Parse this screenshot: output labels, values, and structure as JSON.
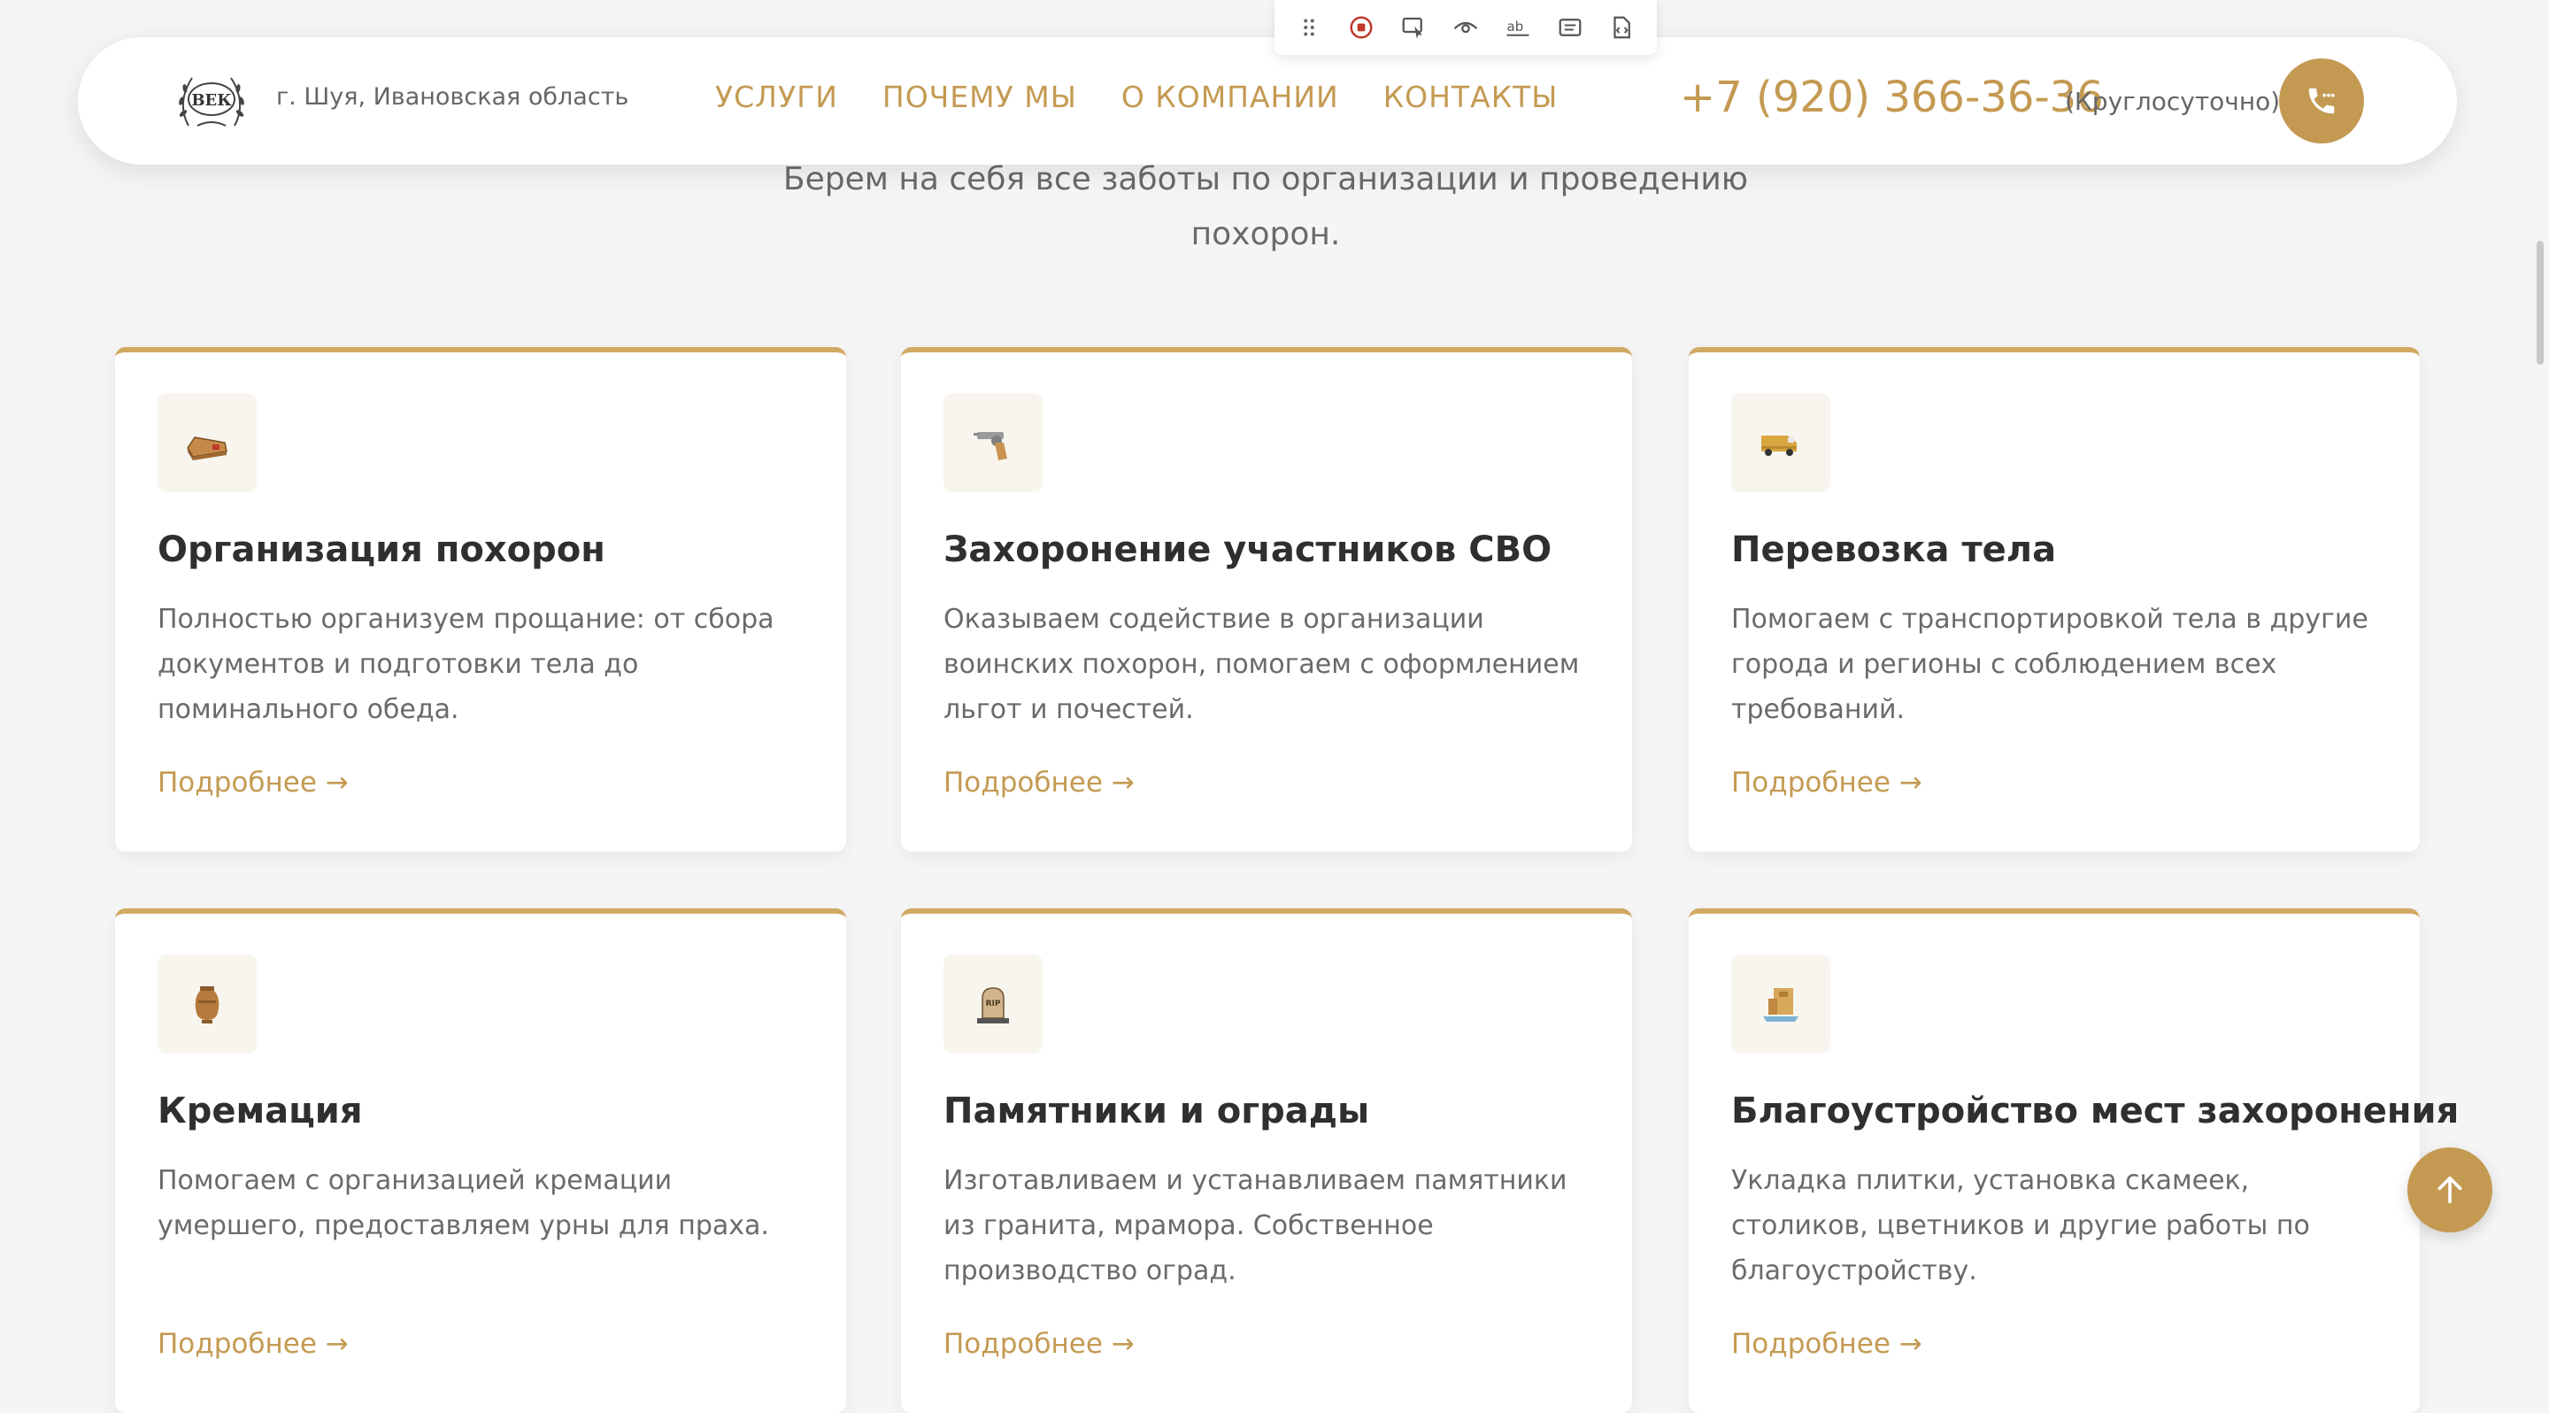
{
  "devtools": {
    "tools": [
      "drag-handle-icon",
      "record-stop-icon",
      "select-element-icon",
      "eye-icon",
      "text-spellcheck-icon",
      "text-block-icon",
      "code-file-icon"
    ]
  },
  "header": {
    "logo_text": "ВЕК",
    "location": "г. Шуя, Ивановская область",
    "nav": [
      "УСЛУГИ",
      "ПОЧЕМУ МЫ",
      "О КОМПАНИИ",
      "КОНТАКТЫ"
    ],
    "phone": "+7 (920) 366-36-36",
    "hours": "(Круглосуточно)",
    "accent_color": "#c49a52"
  },
  "intro": "Берем на себя все заботы по организации и проведению похорон.",
  "services": [
    {
      "icon": "coffin-icon",
      "title": "Организация похорон",
      "text": "Полностью организуем прощание: от сбора документов и подготовки тела до поминального обеда.",
      "link": "Подробнее →"
    },
    {
      "icon": "pistol-icon",
      "title": "Захоронение участников СВО",
      "text": "Оказываем содействие в организации воинских похорон, помогаем с оформлением льгот и почестей.",
      "link": "Подробнее →"
    },
    {
      "icon": "van-icon",
      "title": "Перевозка тела",
      "text": "Помогаем с транспортировкой тела в другие города и регионы с соблюдением всех требований.",
      "link": "Подробнее →"
    },
    {
      "icon": "urn-icon",
      "title": "Кремация",
      "text": "Помогаем с организацией кремации умершего, предоставляем урны для праха.",
      "link": "Подробнее →"
    },
    {
      "icon": "tombstone-icon",
      "title": "Памятники и ограды",
      "text": "Изготавливаем и устанавливаем памятники из гранита, мрамора. Собственное производство оград.",
      "link": "Подробнее →"
    },
    {
      "icon": "landscaping-icon",
      "title": "Благоустройство мест захоронения",
      "text": "Укладка плитки, установка скамеек, столиков, цветников и другие работы по благоустройству.",
      "link": "Подробнее →"
    }
  ]
}
